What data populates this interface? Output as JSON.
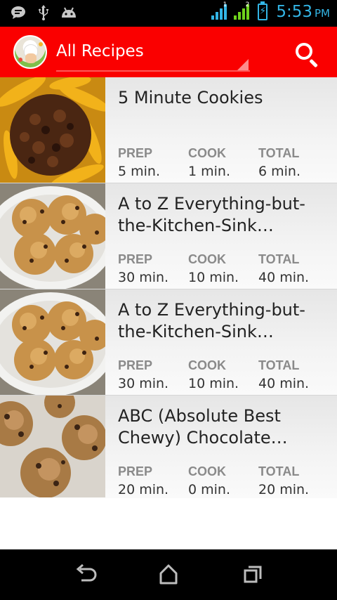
{
  "status_bar": {
    "time": "5:53",
    "ampm": "PM",
    "icons": [
      "chat-icon",
      "usb-icon",
      "android-icon",
      "signal-sim1-icon",
      "signal-sim2-icon",
      "battery-charging-icon"
    ],
    "sim1_label": "1",
    "sim2_label": "2",
    "accent_color": "#33b5e5"
  },
  "action_bar": {
    "title": "All Recipes",
    "background_color": "#fa0000",
    "search_icon": "search-icon"
  },
  "recipes": [
    {
      "title": "5 Minute Cookies",
      "prep_label": "PREP",
      "prep": "5 min.",
      "cook_label": "COOK",
      "cook": "1 min.",
      "total_label": "TOTAL",
      "total": "6 min."
    },
    {
      "title": "A to Z Everything-but-the-Kitchen-Sink…",
      "prep_label": "PREP",
      "prep": "30 min.",
      "cook_label": "COOK",
      "cook": "10 min.",
      "total_label": "TOTAL",
      "total": "40 min."
    },
    {
      "title": "A to Z Everything-but-the-Kitchen-Sink…",
      "prep_label": "PREP",
      "prep": "30 min.",
      "cook_label": "COOK",
      "cook": "10 min.",
      "total_label": "TOTAL",
      "total": "40 min."
    },
    {
      "title": "ABC (Absolute Best Chewy) Chocolate…",
      "prep_label": "PREP",
      "prep": "20 min.",
      "cook_label": "COOK",
      "cook": "0 min.",
      "total_label": "TOTAL",
      "total": "20 min."
    }
  ],
  "nav_bar": {
    "icons": [
      "back-icon",
      "home-icon",
      "recents-icon"
    ]
  }
}
